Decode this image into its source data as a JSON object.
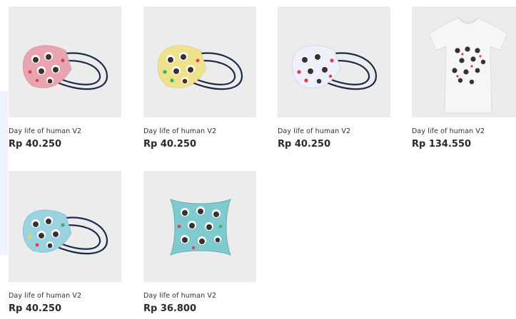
{
  "products": [
    {
      "name": "Day life of human V2",
      "price": "Rp 40.250",
      "type": "mask",
      "color": "#e8a5b0"
    },
    {
      "name": "Day life of human V2",
      "price": "Rp 40.250",
      "type": "mask",
      "color": "#eee28c"
    },
    {
      "name": "Day life of human V2",
      "price": "Rp 40.250",
      "type": "mask",
      "color": "#eef0fb"
    },
    {
      "name": "Day life of human V2",
      "price": "Rp 134.550",
      "type": "tshirt",
      "color": "#f6f6f6"
    },
    {
      "name": "Day life of human V2",
      "price": "Rp 40.250",
      "type": "mask",
      "color": "#9ad2e0"
    },
    {
      "name": "Day life of human V2",
      "price": "Rp 36.800",
      "type": "pillow",
      "color": "#7fcacf"
    }
  ],
  "colors": {
    "thumb_bg": "#ececec",
    "strap": "#1e2a48",
    "text": "#2f2f2f",
    "heart": "#e23a4e"
  }
}
